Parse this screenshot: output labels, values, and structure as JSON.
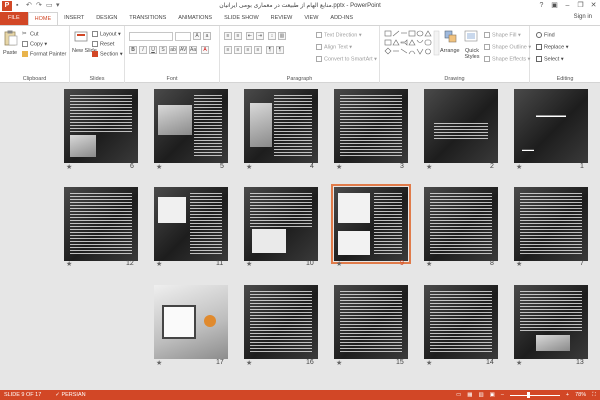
{
  "window": {
    "title": "منابع الهام از طبیعت در معماری بومی ایرانیان.pptx - PowerPoint",
    "app_logo": "P",
    "help": "?",
    "minimize": "–",
    "restore": "❐",
    "close": "✕"
  },
  "tabs": [
    "FILE",
    "HOME",
    "INSERT",
    "DESIGN",
    "TRANSITIONS",
    "ANIMATIONS",
    "SLIDE SHOW",
    "REVIEW",
    "VIEW",
    "ADD-INS"
  ],
  "active_tab": "HOME",
  "signin": "Sign in",
  "ribbon": {
    "clipboard": {
      "label": "Clipboard",
      "paste": "Paste",
      "cut": "Cut",
      "copy": "Copy",
      "format_painter": "Format Painter"
    },
    "slides": {
      "label": "Slides",
      "new_slide": "New Slide",
      "layout": "Layout",
      "reset": "Reset",
      "section": "Section"
    },
    "font": {
      "label": "Font"
    },
    "paragraph": {
      "label": "Paragraph",
      "text_direction": "Text Direction",
      "align_text": "Align Text",
      "convert_smartart": "Convert to SmartArt"
    },
    "drawing": {
      "label": "Drawing",
      "arrange": "Arrange",
      "quick_styles": "Quick Styles",
      "shape_fill": "Shape Fill",
      "shape_outline": "Shape Outline",
      "shape_effects": "Shape Effects"
    },
    "editing": {
      "label": "Editing",
      "find": "Find",
      "replace": "Replace",
      "select": "Select"
    }
  },
  "slides": [
    {
      "num": "1"
    },
    {
      "num": "2"
    },
    {
      "num": "3"
    },
    {
      "num": "4"
    },
    {
      "num": "5"
    },
    {
      "num": "6"
    },
    {
      "num": "7"
    },
    {
      "num": "8"
    },
    {
      "num": "9"
    },
    {
      "num": "10"
    },
    {
      "num": "11"
    },
    {
      "num": "12"
    },
    {
      "num": "13"
    },
    {
      "num": "14"
    },
    {
      "num": "15"
    },
    {
      "num": "16"
    },
    {
      "num": "17"
    }
  ],
  "selected_slide": "9",
  "status": {
    "slide_info": "SLIDE 9 OF 17",
    "language": "PERSIAN",
    "zoom": "78%",
    "zoom_level": 0.78
  },
  "colors": {
    "accent": "#d24726",
    "selection": "#e07b4a",
    "background": "#e6e6e6"
  }
}
